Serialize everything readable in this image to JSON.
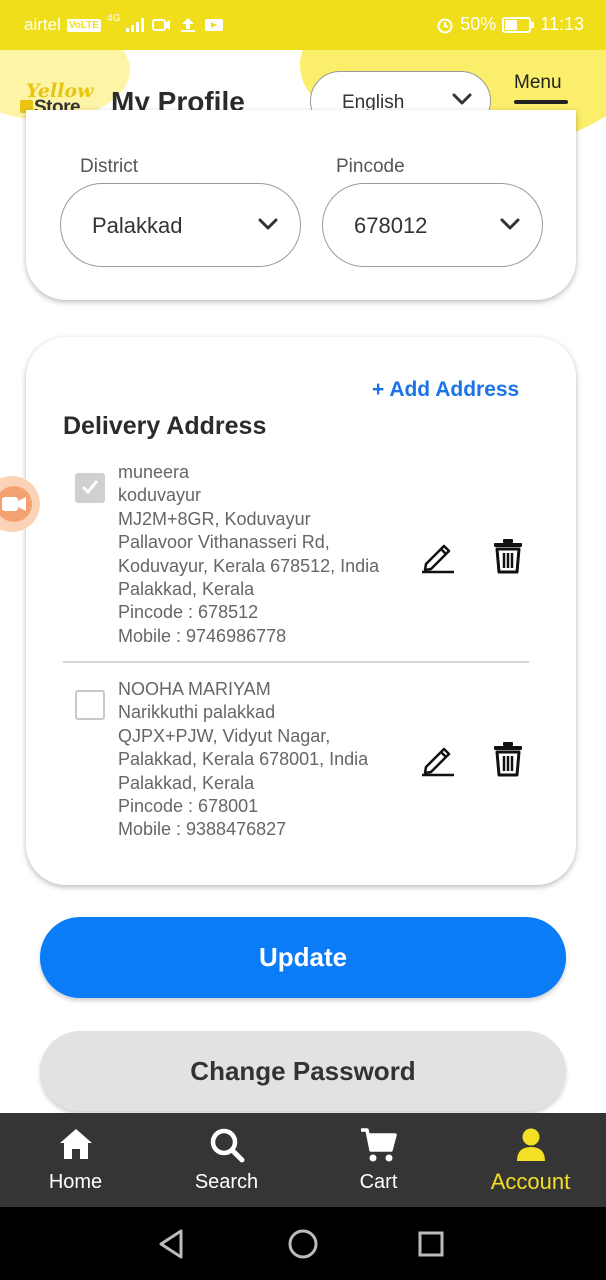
{
  "status_bar": {
    "carrier": "airtel",
    "volte": "VoLTE",
    "network": "4G",
    "battery": "50%",
    "time": "11:13"
  },
  "header": {
    "logo_top": "Yellow",
    "logo_bottom": "Store",
    "title": "My Profile",
    "language": "English",
    "menu_label": "Menu"
  },
  "location": {
    "district_label": "District",
    "district_value": "Palakkad",
    "pincode_label": "Pincode",
    "pincode_value": "678012"
  },
  "delivery": {
    "add_address": "+ Add Address",
    "title": "Delivery Address",
    "addresses": [
      {
        "checked": true,
        "lines": [
          "muneera",
          "koduvayur",
          "MJ2M+8GR, Koduvayur",
          "Pallavoor Vithanasseri Rd,",
          "Koduvayur, Kerala 678512, India",
          "Palakkad, Kerala",
          "Pincode : 678512",
          "Mobile : 9746986778"
        ]
      },
      {
        "checked": false,
        "lines": [
          "NOOHA MARIYAM",
          "Narikkuthi palakkad",
          "QJPX+PJW, Vidyut Nagar,",
          "Palakkad, Kerala 678001, India",
          "Palakkad, Kerala",
          "Pincode : 678001",
          "Mobile : 9388476827"
        ]
      }
    ]
  },
  "actions": {
    "update": "Update",
    "change_password": "Change Password"
  },
  "bottom_nav": {
    "items": [
      {
        "label": "Home",
        "icon": "home-icon"
      },
      {
        "label": "Search",
        "icon": "search-icon"
      },
      {
        "label": "Cart",
        "icon": "cart-icon"
      },
      {
        "label": "Account",
        "icon": "account-icon",
        "active": true
      }
    ]
  },
  "colors": {
    "status_bar": "#f0de1a",
    "accent_blue": "#0a7cf8",
    "link_blue": "#1a73e8",
    "nav_background": "#353535",
    "nav_active": "#f3df26"
  }
}
